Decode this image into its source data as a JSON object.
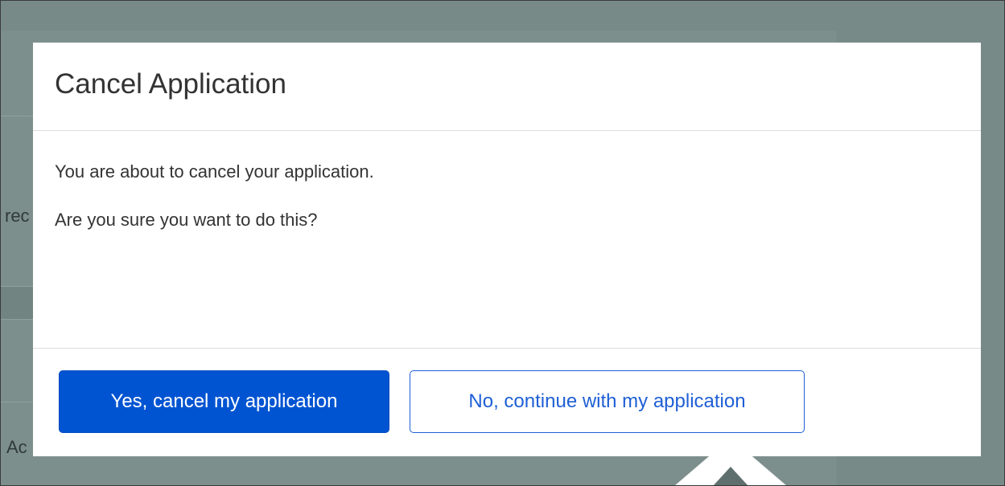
{
  "background": {
    "fragment_left": "rec",
    "fragment_bottom": "Ac"
  },
  "modal": {
    "title": "Cancel Application",
    "body": [
      "You are about to cancel your application.",
      "Are you sure you want to do this?"
    ],
    "confirm_label": "Yes, cancel my application",
    "dismiss_label": "No, continue with my application"
  },
  "icons": {
    "cursor": "cursor-arrow-icon"
  },
  "colors": {
    "overlay": "#778a88",
    "primary": "#0054d2",
    "outline": "#1f5fd6",
    "text": "#333333"
  }
}
